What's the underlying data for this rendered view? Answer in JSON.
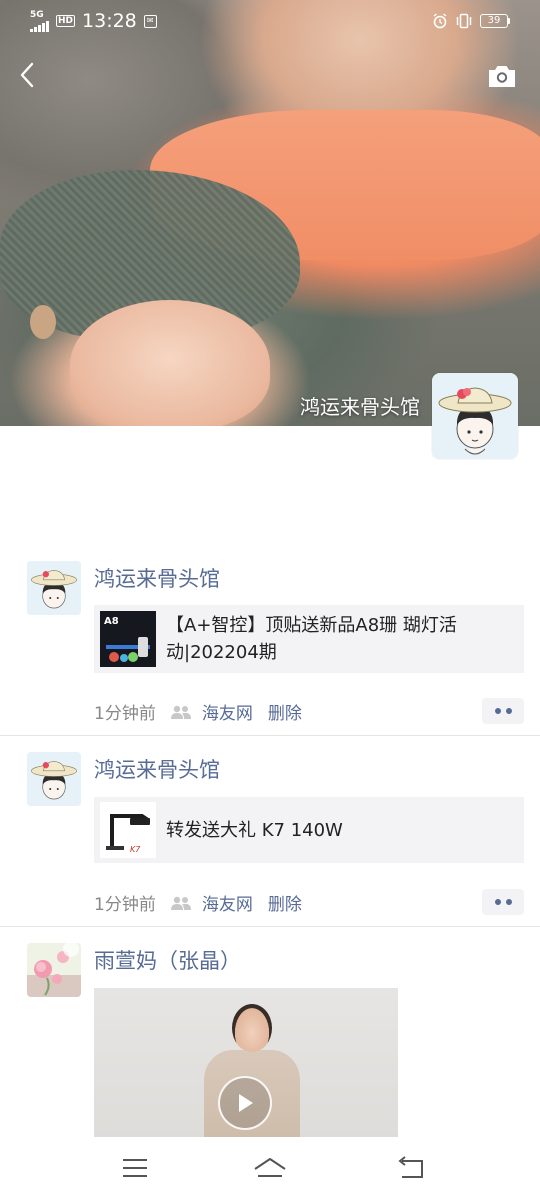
{
  "status_bar": {
    "network": "5G",
    "hd": "HD",
    "time": "13:28",
    "battery": "39",
    "icons": [
      "signal-icon",
      "hd-icon",
      "notification-icon",
      "alarm-icon",
      "vibrate-icon",
      "battery-icon"
    ]
  },
  "header": {
    "back_icon": "back-chevron-icon",
    "camera_icon": "camera-icon",
    "profile_name": "鸿运来骨头馆"
  },
  "posts": [
    {
      "author": "鸿运来骨头馆",
      "card_text": "【A+智控】顶贴送新品A8珊 瑚灯活动|202204期",
      "time": "1分钟前",
      "group": "海友网",
      "delete": "删除",
      "thumb_label": "A8"
    },
    {
      "author": "鸿运来骨头馆",
      "card_text": "转发送大礼 K7 140W",
      "time": "1分钟前",
      "group": "海友网",
      "delete": "删除",
      "thumb_label": "K7"
    },
    {
      "author": "雨萱妈（张晶）",
      "media": "video"
    }
  ],
  "colors": {
    "link": "#576b95",
    "meta": "#888888",
    "card_bg": "#f3f3f5"
  },
  "navbar": {
    "items": [
      "menu-icon",
      "home-icon",
      "return-icon"
    ]
  }
}
